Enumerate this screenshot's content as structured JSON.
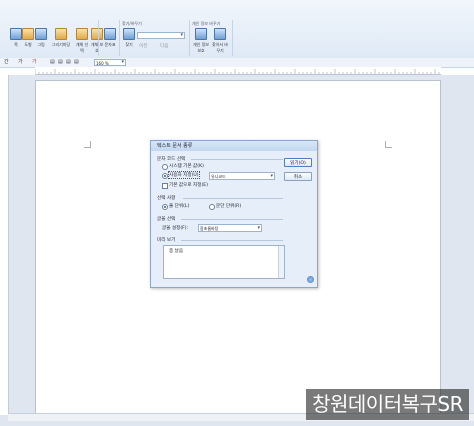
{
  "ribbon": {
    "buttons": [
      {
        "label": "쪽",
        "icon": "page-icon"
      },
      {
        "label": "도형",
        "icon": "shape-icon"
      },
      {
        "label": "그림",
        "icon": "picture-icon"
      },
      {
        "label": "그리기마당",
        "icon": "clipart-icon"
      },
      {
        "label": "개체\n선택",
        "icon": "object-select-icon"
      },
      {
        "label": "개체\n보호",
        "icon": "object-protect-icon"
      },
      {
        "label": "문자표",
        "icon": "symbol-icon"
      },
      {
        "label": "찾기",
        "icon": "find-icon"
      }
    ],
    "group_find_title": "찾기/바꾸기",
    "group_track_title": "개인 정보 바꾸기",
    "find_combo": "",
    "prev_label": "이전",
    "next_label": "다음",
    "track_buttons": [
      "개인 정보 보호",
      "찾아서 바꾸기"
    ]
  },
  "format_bar": {
    "items": [
      "간",
      "가",
      "가"
    ],
    "zoom": "160 %"
  },
  "dialog": {
    "title": "텍스트 문서 종류",
    "section_encoding": "문자 코드 선택",
    "opt_system": "시스템 기본 값(K)",
    "opt_user": "사용자 지정(U)",
    "user_value": "유니코드",
    "check_default": "기본 값으로 지정(E)",
    "section_select": "선택 사항",
    "opt_line": "줄 단위(L)",
    "opt_para": "문단 단위(R)",
    "section_font": "글꼴 선택",
    "font_label": "글꼴 설정(F):",
    "font_value": "함초롬바탕",
    "section_preview": "미리 보기",
    "preview_text": "종 날음",
    "ok_label": "읽기(O)",
    "cancel_label": "취소"
  },
  "watermark": "창원데이터복구SR"
}
